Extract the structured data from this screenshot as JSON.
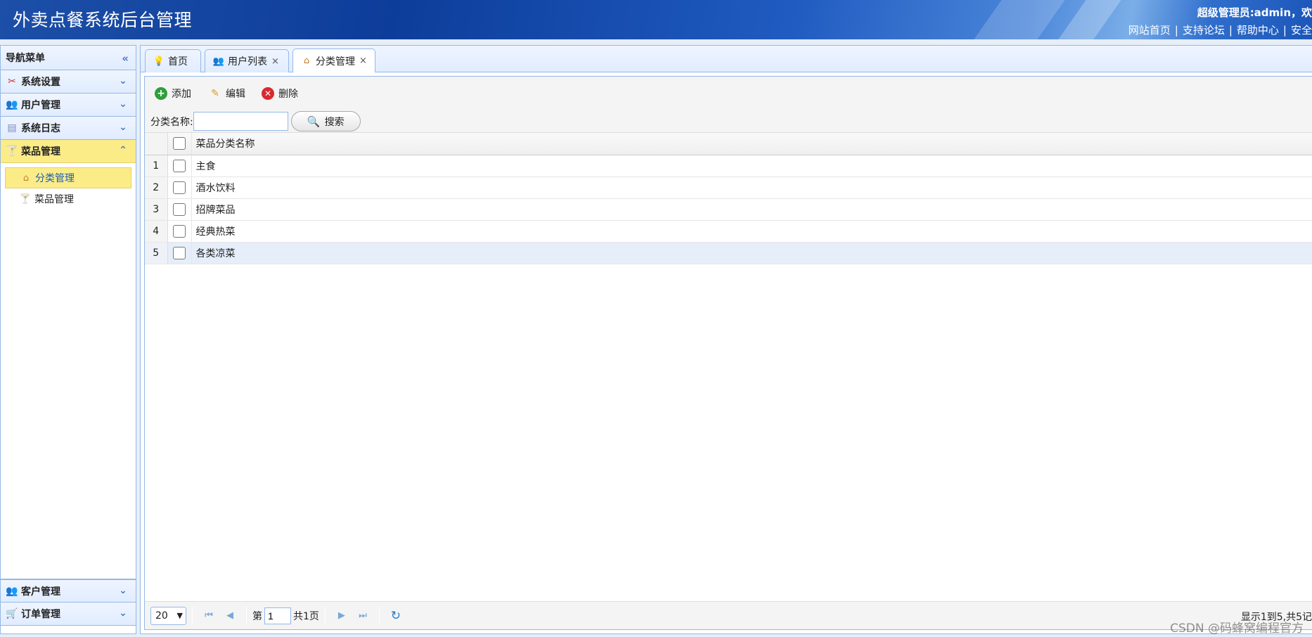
{
  "header": {
    "title": "外卖点餐系统后台管理",
    "user_info": "超级管理员:admin，欢",
    "links": [
      "网站首页",
      "支持论坛",
      "帮助中心",
      "安全"
    ]
  },
  "sidebar": {
    "title": "导航菜单",
    "panels": [
      {
        "label": "系统设置",
        "icon": "tools-icon"
      },
      {
        "label": "用户管理",
        "icon": "users-icon"
      },
      {
        "label": "系统日志",
        "icon": "log-icon"
      },
      {
        "label": "菜品管理",
        "icon": "dish-icon"
      }
    ],
    "sub_items": [
      {
        "label": "分类管理",
        "icon": "category-icon"
      },
      {
        "label": "菜品管理",
        "icon": "dish-icon"
      }
    ],
    "bottom_panels": [
      {
        "label": "客户管理",
        "icon": "users-icon"
      },
      {
        "label": "订单管理",
        "icon": "cart-icon"
      }
    ]
  },
  "tabs": [
    {
      "label": "首页",
      "icon": "bulb-icon"
    },
    {
      "label": "用户列表",
      "icon": "users-icon"
    },
    {
      "label": "分类管理",
      "icon": "category-icon"
    }
  ],
  "toolbar": {
    "add_label": "添加",
    "edit_label": "编辑",
    "delete_label": "删除",
    "search_label": "分类名称:",
    "search_value": "",
    "search_button": "搜索"
  },
  "table": {
    "header": "菜品分类名称",
    "rows": [
      {
        "num": "1",
        "name": "主食"
      },
      {
        "num": "2",
        "name": "酒水饮料"
      },
      {
        "num": "3",
        "name": "招牌菜品"
      },
      {
        "num": "4",
        "name": "经典热菜"
      },
      {
        "num": "5",
        "name": "各类凉菜"
      }
    ]
  },
  "pager": {
    "page_size": "20",
    "page_prefix": "第",
    "page_value": "1",
    "page_suffix": "共1页",
    "info": "显示1到5,共5记"
  },
  "watermark": "CSDN @码蜂窝编程官方",
  "colors": {
    "header_blue": "#0d3d9a",
    "highlight_yellow": "#fbec88",
    "border_blue": "#95b8e7"
  }
}
